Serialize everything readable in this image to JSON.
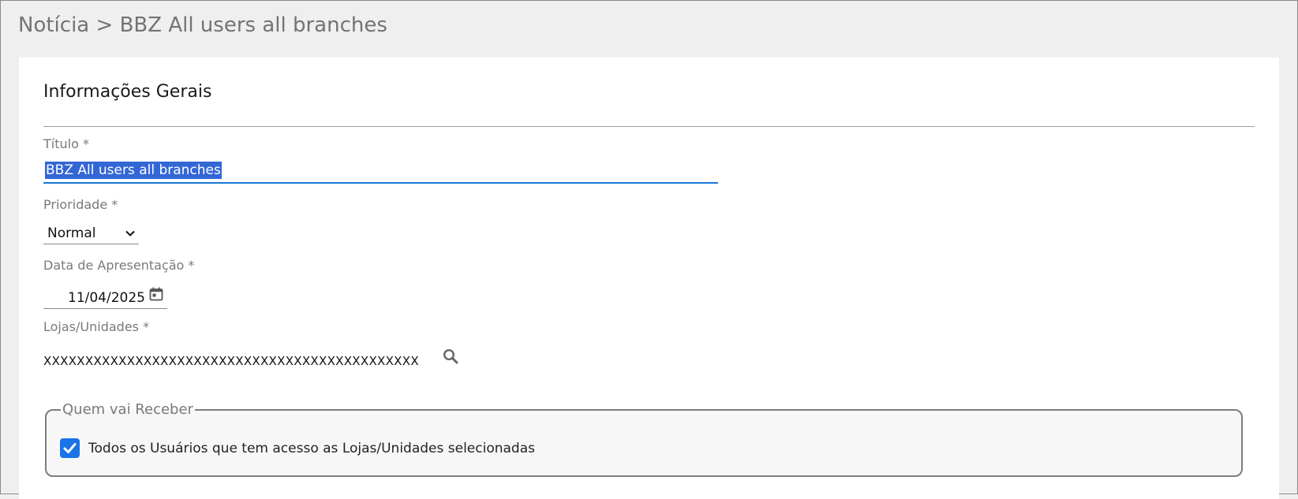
{
  "breadcrumb": {
    "section": "Notícia",
    "separator": ">",
    "current": "BBZ All users all branches"
  },
  "form": {
    "section_title": "Informações Gerais",
    "titulo": {
      "label": "Título *",
      "value": "BBZ All users all branches"
    },
    "prioridade": {
      "label": "Prioridade *",
      "value": "Normal"
    },
    "data": {
      "label": "Data de Apresentação *",
      "value": "11/04/2025"
    },
    "lojas": {
      "label": "Lojas/Unidades *",
      "value": "XXXXXXXXXXXXXXXXXXXXXXXXXXXXXXXXXXXXXXXXXXXXX"
    },
    "receber": {
      "legend": "Quem vai Receber",
      "checkbox_label": "Todos os Usuários que tem acesso as Lojas/Unidades selecionadas",
      "checked": true
    }
  },
  "icons": {
    "dropdown": "chevron-down-icon",
    "date": "calendar-icon",
    "lookup": "search-icon",
    "check": "checkmark-icon"
  },
  "colors": {
    "accent": "#1976d2",
    "selection": "#3367d6",
    "checkbox": "#1a73e8"
  }
}
